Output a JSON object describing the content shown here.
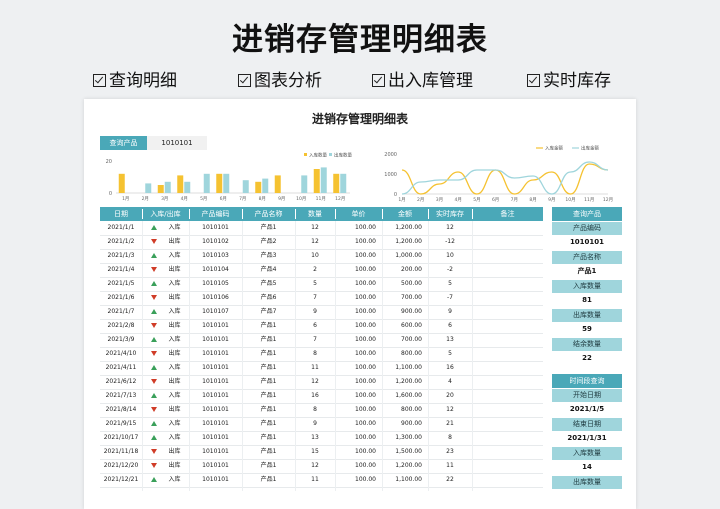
{
  "title": "进销存管理明细表",
  "features": [
    "查询明细",
    "图表分析",
    "出入库管理",
    "实时库存"
  ],
  "sheet": {
    "title": "进销存管理明细表",
    "query": {
      "label": "查询产品",
      "value": "1010101"
    }
  },
  "chart_data": [
    {
      "type": "bar",
      "categories": [
        "1月",
        "2月",
        "3月",
        "4月",
        "5月",
        "6月",
        "7月",
        "8月",
        "9月",
        "10月",
        "11月",
        "12月"
      ],
      "series": [
        {
          "name": "入库数量",
          "values": [
            12,
            0,
            5,
            11,
            0,
            12,
            0,
            7,
            11,
            0,
            15,
            12
          ],
          "color": "#f5c231"
        },
        {
          "name": "出库数量",
          "values": [
            0,
            6,
            7,
            7,
            12,
            12,
            8,
            9,
            0,
            11,
            16,
            12
          ],
          "color": "#9fd5dc"
        }
      ],
      "ylim": [
        0,
        20
      ],
      "yticks": [
        0,
        20
      ],
      "legend": "top-right"
    },
    {
      "type": "line",
      "categories": [
        "1月",
        "2月",
        "3月",
        "4月",
        "5月",
        "6月",
        "7月",
        "8月",
        "9月",
        "10月",
        "11月",
        "12月"
      ],
      "series": [
        {
          "name": "入库金额",
          "values": [
            1200,
            0,
            500,
            1100,
            0,
            1200,
            0,
            700,
            1100,
            0,
            1500,
            1200
          ],
          "color": "#f5c231"
        },
        {
          "name": "出库金额",
          "values": [
            0,
            600,
            700,
            700,
            1200,
            1200,
            800,
            900,
            0,
            1100,
            1600,
            1200
          ],
          "color": "#9fd5dc"
        }
      ],
      "ylim": [
        0,
        2000
      ],
      "yticks": [
        0,
        1000,
        2000
      ],
      "legend": "top-right"
    }
  ],
  "table": {
    "headers": [
      "日期",
      "入库/出库",
      "产品编码",
      "产品名称",
      "数量",
      "单价",
      "金额",
      "实时库存",
      "备注"
    ],
    "rows": [
      {
        "date": "2021/1/1",
        "dir": "up",
        "type": "入库",
        "code": "1010101",
        "name": "产品1",
        "qty": "12",
        "price": "100.00",
        "amount": "1,200.00",
        "stock": "12",
        "note": ""
      },
      {
        "date": "2021/1/2",
        "dir": "down",
        "type": "出库",
        "code": "1010102",
        "name": "产品2",
        "qty": "12",
        "price": "100.00",
        "amount": "1,200.00",
        "stock": "-12",
        "note": ""
      },
      {
        "date": "2021/1/3",
        "dir": "up",
        "type": "入库",
        "code": "1010103",
        "name": "产品3",
        "qty": "10",
        "price": "100.00",
        "amount": "1,000.00",
        "stock": "10",
        "note": ""
      },
      {
        "date": "2021/1/4",
        "dir": "down",
        "type": "出库",
        "code": "1010104",
        "name": "产品4",
        "qty": "2",
        "price": "100.00",
        "amount": "200.00",
        "stock": "-2",
        "note": ""
      },
      {
        "date": "2021/1/5",
        "dir": "up",
        "type": "入库",
        "code": "1010105",
        "name": "产品5",
        "qty": "5",
        "price": "100.00",
        "amount": "500.00",
        "stock": "5",
        "note": ""
      },
      {
        "date": "2021/1/6",
        "dir": "down",
        "type": "出库",
        "code": "1010106",
        "name": "产品6",
        "qty": "7",
        "price": "100.00",
        "amount": "700.00",
        "stock": "-7",
        "note": ""
      },
      {
        "date": "2021/1/7",
        "dir": "up",
        "type": "入库",
        "code": "1010107",
        "name": "产品7",
        "qty": "9",
        "price": "100.00",
        "amount": "900.00",
        "stock": "9",
        "note": ""
      },
      {
        "date": "2021/2/8",
        "dir": "down",
        "type": "出库",
        "code": "1010101",
        "name": "产品1",
        "qty": "6",
        "price": "100.00",
        "amount": "600.00",
        "stock": "6",
        "note": ""
      },
      {
        "date": "2021/3/9",
        "dir": "up",
        "type": "入库",
        "code": "1010101",
        "name": "产品1",
        "qty": "7",
        "price": "100.00",
        "amount": "700.00",
        "stock": "13",
        "note": ""
      },
      {
        "date": "2021/4/10",
        "dir": "down",
        "type": "出库",
        "code": "1010101",
        "name": "产品1",
        "qty": "8",
        "price": "100.00",
        "amount": "800.00",
        "stock": "5",
        "note": ""
      },
      {
        "date": "2021/4/11",
        "dir": "up",
        "type": "入库",
        "code": "1010101",
        "name": "产品1",
        "qty": "11",
        "price": "100.00",
        "amount": "1,100.00",
        "stock": "16",
        "note": ""
      },
      {
        "date": "2021/6/12",
        "dir": "down",
        "type": "出库",
        "code": "1010101",
        "name": "产品1",
        "qty": "12",
        "price": "100.00",
        "amount": "1,200.00",
        "stock": "4",
        "note": ""
      },
      {
        "date": "2021/7/13",
        "dir": "up",
        "type": "入库",
        "code": "1010101",
        "name": "产品1",
        "qty": "16",
        "price": "100.00",
        "amount": "1,600.00",
        "stock": "20",
        "note": ""
      },
      {
        "date": "2021/8/14",
        "dir": "down",
        "type": "出库",
        "code": "1010101",
        "name": "产品1",
        "qty": "8",
        "price": "100.00",
        "amount": "800.00",
        "stock": "12",
        "note": ""
      },
      {
        "date": "2021/9/15",
        "dir": "up",
        "type": "入库",
        "code": "1010101",
        "name": "产品1",
        "qty": "9",
        "price": "100.00",
        "amount": "900.00",
        "stock": "21",
        "note": ""
      },
      {
        "date": "2021/10/17",
        "dir": "up",
        "type": "入库",
        "code": "1010101",
        "name": "产品1",
        "qty": "13",
        "price": "100.00",
        "amount": "1,300.00",
        "stock": "8",
        "note": ""
      },
      {
        "date": "2021/11/18",
        "dir": "down",
        "type": "出库",
        "code": "1010101",
        "name": "产品1",
        "qty": "15",
        "price": "100.00",
        "amount": "1,500.00",
        "stock": "23",
        "note": ""
      },
      {
        "date": "2021/12/20",
        "dir": "down",
        "type": "出库",
        "code": "1010101",
        "name": "产品1",
        "qty": "12",
        "price": "100.00",
        "amount": "1,200.00",
        "stock": "11",
        "note": ""
      },
      {
        "date": "2021/12/21",
        "dir": "up",
        "type": "入库",
        "code": "1010101",
        "name": "产品1",
        "qty": "11",
        "price": "100.00",
        "amount": "1,100.00",
        "stock": "22",
        "note": ""
      }
    ]
  },
  "side": {
    "query_header": "查询产品",
    "query_items": [
      {
        "label": "产品编码",
        "value": "1010101"
      },
      {
        "label": "产品名称",
        "value": "产品1"
      },
      {
        "label": "入库数量",
        "value": "81"
      },
      {
        "label": "出库数量",
        "value": "59"
      },
      {
        "label": "结余数量",
        "value": "22"
      }
    ],
    "time_header": "时间段查询",
    "time_items": [
      {
        "label": "开始日期",
        "value": "2021/1/5"
      },
      {
        "label": "结束日期",
        "value": "2021/1/31"
      },
      {
        "label": "入库数量",
        "value": "14"
      },
      {
        "label": "出库数量",
        "value": ""
      }
    ]
  },
  "colors": {
    "header": "#4aa8b8",
    "label": "#9fd5dc",
    "in": "#f5c231",
    "out": "#9fd5dc",
    "up_arrow": "#3aa05a",
    "down_arrow": "#d03c28"
  }
}
